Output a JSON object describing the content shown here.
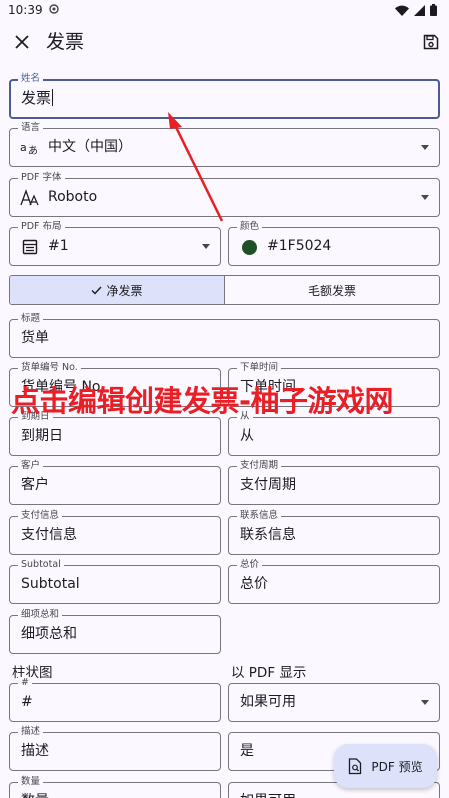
{
  "status": {
    "time": "10:39"
  },
  "appbar": {
    "title": "发票"
  },
  "fields": {
    "name": {
      "label": "姓名",
      "value": "发票"
    },
    "language": {
      "label": "语言",
      "value": "中文（中国）"
    },
    "font": {
      "label": "PDF 字体",
      "value": "Roboto"
    },
    "layout": {
      "label": "PDF 布局",
      "value": "#1"
    },
    "color": {
      "label": "颜色",
      "value": "#1F5024",
      "swatch": "#1f5024"
    },
    "heading": {
      "label": "标题",
      "value": "货单"
    },
    "invoice_no": {
      "label": "货单编号 No.",
      "value": "货单编号 No."
    },
    "order_time": {
      "label": "下单时间",
      "value": "下单时间"
    },
    "due_date": {
      "label": "到期日",
      "value": "到期日"
    },
    "from": {
      "label": "从",
      "value": "从"
    },
    "customer": {
      "label": "客户",
      "value": "客户"
    },
    "payment_term": {
      "label": "支付周期",
      "value": "支付周期"
    },
    "payment_info": {
      "label": "支付信息",
      "value": "支付信息"
    },
    "contact_info": {
      "label": "联系信息",
      "value": "联系信息"
    },
    "subtotal": {
      "label": "Subtotal",
      "value": "Subtotal"
    },
    "total": {
      "label": "总价",
      "value": "总价"
    },
    "item_total": {
      "label": "细项总和",
      "value": "细项总和"
    },
    "hash": {
      "label": "#",
      "value": "#"
    },
    "show_pdf": {
      "value": "如果可用"
    },
    "description": {
      "label": "描述",
      "value": "描述"
    },
    "yes": {
      "value": "是"
    },
    "quantity": {
      "label": "数量",
      "value": "数量"
    },
    "show_pdf_2": {
      "value": "如果可用"
    }
  },
  "segmented": {
    "net": "净发票",
    "gross": "毛额发票"
  },
  "sections": {
    "columns": "柱状图",
    "show_in_pdf": "以 PDF 显示"
  },
  "overlay": "点击编辑创建发票-柚子游戏网",
  "fab": {
    "label": "PDF 预览"
  },
  "colors": {
    "accent": "#4c5c92",
    "overlay": "#ea1e25"
  }
}
